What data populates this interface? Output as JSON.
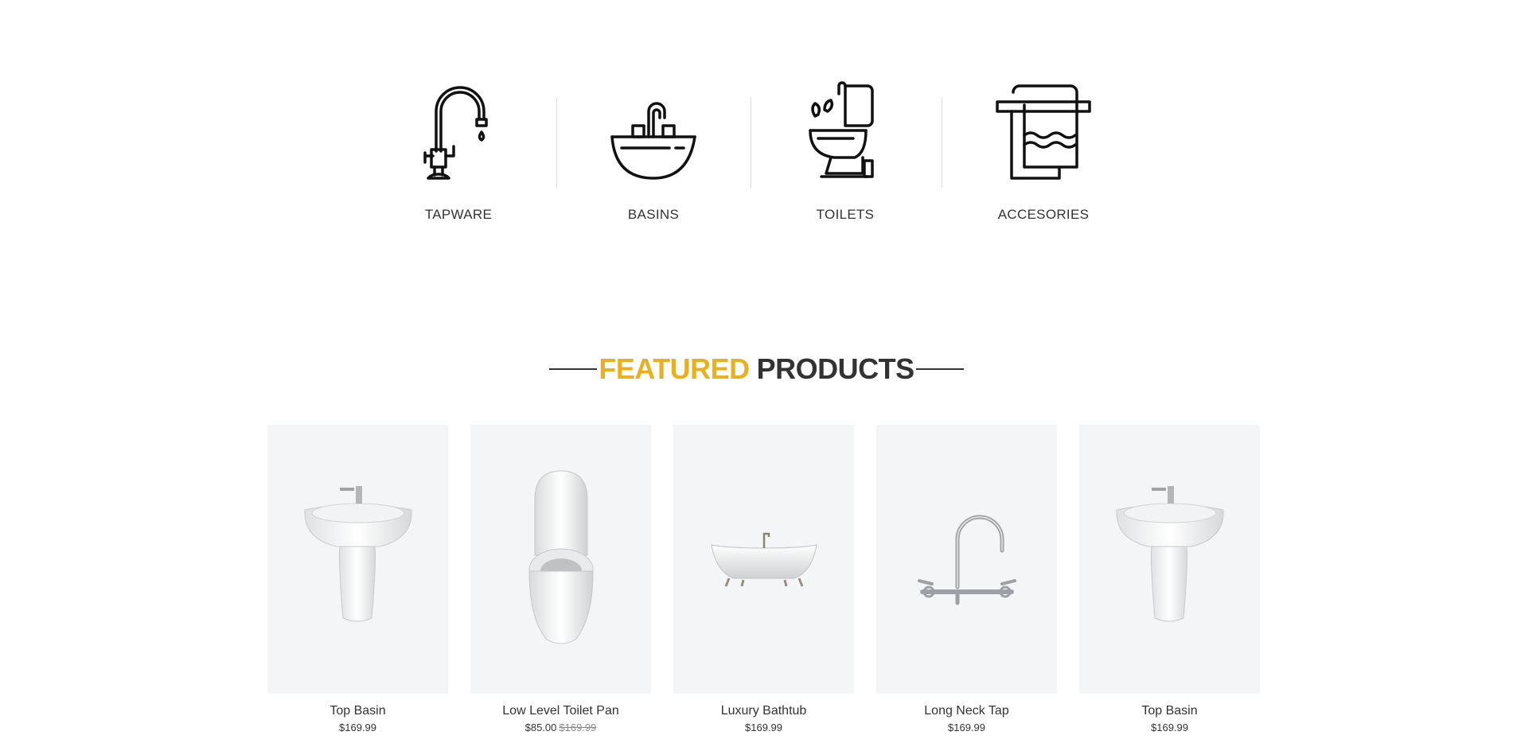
{
  "categories": [
    {
      "label": "TAPWARE",
      "icon": "faucet-icon"
    },
    {
      "label": "BASINS",
      "icon": "basin-icon"
    },
    {
      "label": "TOILETS",
      "icon": "toilet-icon"
    },
    {
      "label": "ACCESORIES",
      "icon": "towel-rack-icon"
    }
  ],
  "featured": {
    "highlight": "FEATURED",
    "rest": "PRODUCTS",
    "highlight_color": "#e9b020"
  },
  "products": [
    {
      "name": "Top Basin",
      "price": "$169.99",
      "old_price": "",
      "image": "pedestal-basin-image"
    },
    {
      "name": "Low Level Toilet Pan",
      "price": "$85.00",
      "old_price": "$169.99",
      "image": "toilet-image"
    },
    {
      "name": "Luxury Bathtub",
      "price": "$169.99",
      "old_price": "",
      "image": "bathtub-image"
    },
    {
      "name": "Long Neck Tap",
      "price": "$169.99",
      "old_price": "",
      "image": "tap-image"
    },
    {
      "name": "Top Basin",
      "price": "$169.99",
      "old_price": "",
      "image": "pedestal-basin-image"
    }
  ]
}
